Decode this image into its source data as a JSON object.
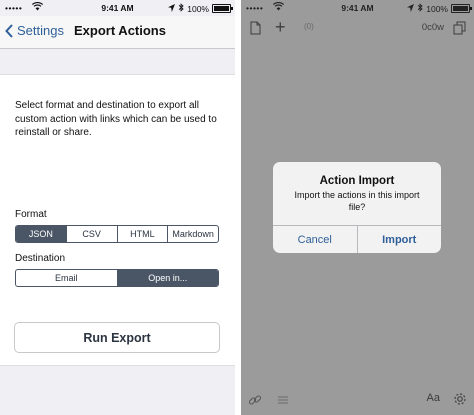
{
  "left_status": {
    "carrier": "•••••",
    "time": "9:41 AM",
    "battery": "100%"
  },
  "right_status": {
    "carrier": "•••••",
    "time": "9:41 AM",
    "battery": "100%"
  },
  "nav": {
    "back_label": "Settings",
    "title": "Export Actions"
  },
  "description": "Select format and destination to export all custom action with links which can be used to reinstall or share.",
  "format": {
    "label": "Format",
    "options": [
      "JSON",
      "CSV",
      "HTML",
      "Markdown"
    ],
    "selected": "JSON"
  },
  "destination": {
    "label": "Destination",
    "options": [
      "Email",
      "Open in..."
    ],
    "selected": "Open in..."
  },
  "run_button": "Run Export",
  "editor": {
    "counter": "0c0w",
    "font_button": "Aa",
    "counter_icon_text": "(0)"
  },
  "alert": {
    "title": "Action Import",
    "message": "Import the actions in this import file?",
    "cancel": "Cancel",
    "confirm": "Import"
  },
  "colors": {
    "accent": "#2f5f99",
    "segment": "#4a5666",
    "dimmed_background": "#9b9b9b"
  },
  "icons": [
    "back-chevron-icon",
    "wifi-icon",
    "location-icon",
    "bluetooth-icon",
    "battery-icon",
    "document-icon",
    "plus-icon",
    "copy-icon",
    "link-icon",
    "list-icon",
    "gear-icon"
  ]
}
